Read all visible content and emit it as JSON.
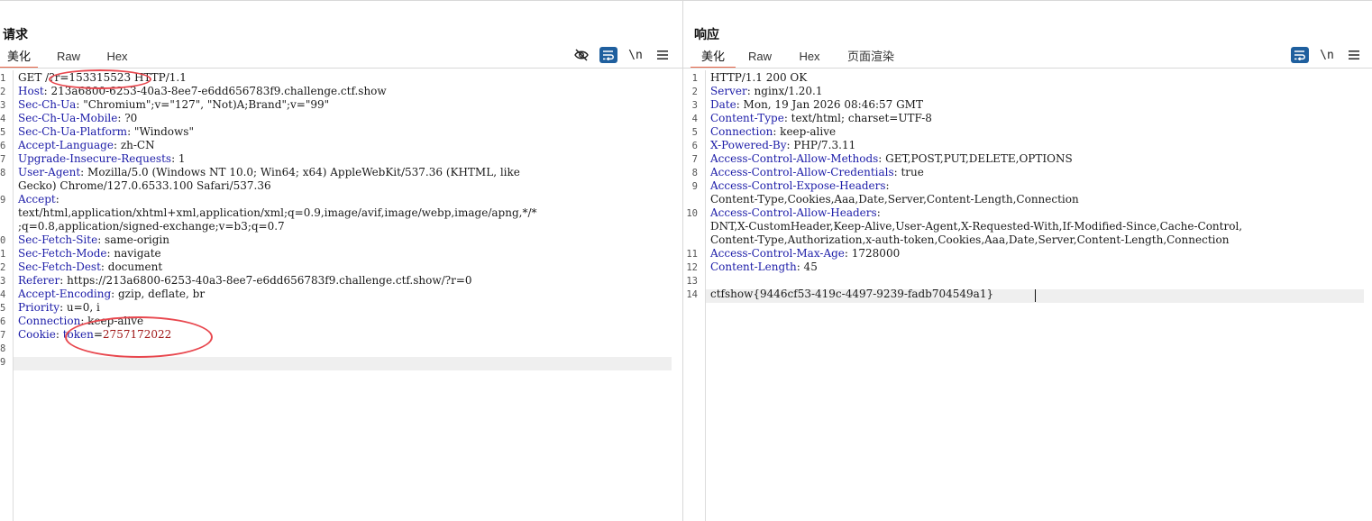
{
  "request": {
    "title": "请求",
    "tabs": [
      "美化",
      "Raw",
      "Hex"
    ],
    "active_tab": "美化",
    "toolbar": {
      "newline_label": "\\n"
    },
    "lines": [
      [
        [
          "m",
          "GET /?r=153315523 HTTP/1.1"
        ]
      ],
      [
        [
          "k",
          "Host"
        ],
        [
          "v",
          ": 213a6800-6253-40a3-8ee7-e6dd656783f9.challenge.ctf.show"
        ]
      ],
      [
        [
          "k",
          "Sec-Ch-Ua"
        ],
        [
          "v",
          ": \"Chromium\";v=\"127\", \"Not)A;Brand\";v=\"99\""
        ]
      ],
      [
        [
          "k",
          "Sec-Ch-Ua-Mobile"
        ],
        [
          "v",
          ": ?0"
        ]
      ],
      [
        [
          "k",
          "Sec-Ch-Ua-Platform"
        ],
        [
          "v",
          ": \"Windows\""
        ]
      ],
      [
        [
          "k",
          "Accept-Language"
        ],
        [
          "v",
          ": zh-CN"
        ]
      ],
      [
        [
          "k",
          "Upgrade-Insecure-Requests"
        ],
        [
          "v",
          ": 1"
        ]
      ],
      [
        [
          "k",
          "User-Agent"
        ],
        [
          "v",
          ": Mozilla/5.0 (Windows NT 10.0; Win64; x64) AppleWebKit/537.36 (KHTML, like"
        ]
      ],
      [
        [
          "v",
          "Gecko) Chrome/127.0.6533.100 Safari/537.36"
        ]
      ],
      [
        [
          "k",
          "Accept"
        ],
        [
          "v",
          ":"
        ]
      ],
      [
        [
          "v",
          "text/html,application/xhtml+xml,application/xml;q=0.9,image/avif,image/webp,image/apng,*/*"
        ]
      ],
      [
        [
          "v",
          ";q=0.8,application/signed-exchange;v=b3;q=0.7"
        ]
      ],
      [
        [
          "k",
          "Sec-Fetch-Site"
        ],
        [
          "v",
          ": same-origin"
        ]
      ],
      [
        [
          "k",
          "Sec-Fetch-Mode"
        ],
        [
          "v",
          ": navigate"
        ]
      ],
      [
        [
          "k",
          "Sec-Fetch-Dest"
        ],
        [
          "v",
          ": document"
        ]
      ],
      [
        [
          "k",
          "Referer"
        ],
        [
          "v",
          ": https://213a6800-6253-40a3-8ee7-e6dd656783f9.challenge.ctf.show/?r=0"
        ]
      ],
      [
        [
          "k",
          "Accept-Encoding"
        ],
        [
          "v",
          ": gzip, deflate, br"
        ]
      ],
      [
        [
          "k",
          "Priority"
        ],
        [
          "v",
          ": u=0, i"
        ]
      ],
      [
        [
          "k",
          "Connection"
        ],
        [
          "v",
          ": keep-alive"
        ]
      ],
      [
        [
          "k",
          "Cookie"
        ],
        [
          "v",
          ": "
        ],
        [
          "k",
          "token"
        ],
        [
          "v",
          "="
        ],
        [
          "dv",
          "2757172022"
        ]
      ],
      [
        [
          "v",
          ""
        ]
      ],
      [
        [
          "v",
          ""
        ]
      ]
    ],
    "line_numbers": [
      "1",
      "2",
      "3",
      "4",
      "5",
      "6",
      "7",
      "8",
      "",
      "9",
      "",
      "",
      "0",
      "1",
      "2",
      "3",
      "4",
      "5",
      "6",
      "7",
      "8",
      "9"
    ]
  },
  "response": {
    "title": "响应",
    "tabs": [
      "美化",
      "Raw",
      "Hex",
      "页面渲染"
    ],
    "active_tab": "美化",
    "toolbar": {
      "newline_label": "\\n"
    },
    "lines": [
      [
        [
          "v",
          "HTTP/1.1 200 OK"
        ]
      ],
      [
        [
          "k",
          "Server"
        ],
        [
          "v",
          ": nginx/1.20.1"
        ]
      ],
      [
        [
          "k",
          "Date"
        ],
        [
          "v",
          ": Mon, 19 Jan 2026 08:46:57 GMT"
        ]
      ],
      [
        [
          "k",
          "Content-Type"
        ],
        [
          "v",
          ": text/html; charset=UTF-8"
        ]
      ],
      [
        [
          "k",
          "Connection"
        ],
        [
          "v",
          ": keep-alive"
        ]
      ],
      [
        [
          "k",
          "X-Powered-By"
        ],
        [
          "v",
          ": PHP/7.3.11"
        ]
      ],
      [
        [
          "k",
          "Access-Control-Allow-Methods"
        ],
        [
          "v",
          ": GET,POST,PUT,DELETE,OPTIONS"
        ]
      ],
      [
        [
          "k",
          "Access-Control-Allow-Credentials"
        ],
        [
          "v",
          ": true"
        ]
      ],
      [
        [
          "k",
          "Access-Control-Expose-Headers"
        ],
        [
          "v",
          ":"
        ]
      ],
      [
        [
          "v",
          "Content-Type,Cookies,Aaa,Date,Server,Content-Length,Connection"
        ]
      ],
      [
        [
          "k",
          "Access-Control-Allow-Headers"
        ],
        [
          "v",
          ":"
        ]
      ],
      [
        [
          "v",
          "DNT,X-CustomHeader,Keep-Alive,User-Agent,X-Requested-With,If-Modified-Since,Cache-Control,"
        ]
      ],
      [
        [
          "v",
          "Content-Type,Authorization,x-auth-token,Cookies,Aaa,Date,Server,Content-Length,Connection"
        ]
      ],
      [
        [
          "k",
          "Access-Control-Max-Age"
        ],
        [
          "v",
          ": 1728000"
        ]
      ],
      [
        [
          "k",
          "Content-Length"
        ],
        [
          "v",
          ": 45"
        ]
      ],
      [
        [
          "v",
          ""
        ]
      ],
      [
        [
          "v",
          "ctfshow{9446cf53-419c-4497-9239-fadb704549a1}"
        ]
      ]
    ],
    "line_numbers": [
      "1",
      "2",
      "3",
      "4",
      "5",
      "6",
      "7",
      "8",
      "9",
      "",
      "10",
      "",
      "",
      "11",
      "12",
      "13",
      "14"
    ]
  },
  "colors": {
    "accent_tab": "#e8684a",
    "button_blue": "#1f5f9e",
    "annotation_red": "#e8474e",
    "header_key": "#1c1ca8",
    "cookie_value": "#a01818"
  },
  "icons": [
    "eye-slash-icon",
    "wrap-icon",
    "newline-icon",
    "menu-icon",
    "layout-split-icon",
    "layout-rows-icon",
    "layout-single-icon"
  ]
}
